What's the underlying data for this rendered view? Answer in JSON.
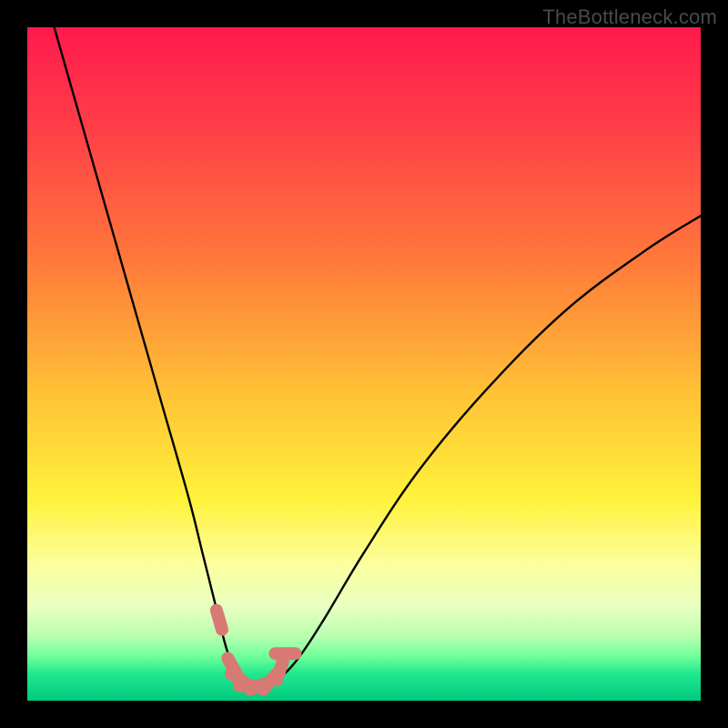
{
  "watermark": "TheBottleneck.com",
  "colors": {
    "frame": "#000000",
    "curve_stroke": "#000000",
    "marker_fill": "#d77a74",
    "marker_stroke": "#c56a64",
    "gradient_stops": [
      {
        "offset": 0.0,
        "color": "#ff1a4d"
      },
      {
        "offset": 0.15,
        "color": "#ff3e48"
      },
      {
        "offset": 0.35,
        "color": "#ff7a3a"
      },
      {
        "offset": 0.55,
        "color": "#ffc436"
      },
      {
        "offset": 0.7,
        "color": "#fff23a"
      },
      {
        "offset": 0.8,
        "color": "#fbffa0"
      },
      {
        "offset": 0.86,
        "color": "#e9ffc0"
      },
      {
        "offset": 0.905,
        "color": "#b8ffb0"
      },
      {
        "offset": 0.935,
        "color": "#6dff9a"
      },
      {
        "offset": 0.96,
        "color": "#20e88f"
      },
      {
        "offset": 1.0,
        "color": "#00c97e"
      }
    ]
  },
  "chart_data": {
    "type": "line",
    "title": "",
    "xlabel": "",
    "ylabel": "",
    "xlim": [
      0,
      100
    ],
    "ylim": [
      0,
      100
    ],
    "series": [
      {
        "name": "bottleneck-curve",
        "x": [
          4,
          8,
          12,
          16,
          20,
          24,
          26,
          28,
          29.5,
          31,
          33,
          35,
          37,
          40,
          44,
          50,
          58,
          68,
          80,
          92,
          100
        ],
        "values": [
          100,
          86,
          72,
          58,
          44,
          30,
          22,
          14,
          8,
          4,
          2,
          2,
          3,
          6,
          12,
          22,
          34,
          46,
          58,
          67,
          72
        ]
      }
    ],
    "markers": {
      "name": "highlight-points",
      "x": [
        28.5,
        30.5,
        31.5,
        33.0,
        34.5,
        36.0,
        37.5,
        38.3
      ],
      "values": [
        12.0,
        5.0,
        3.2,
        2.2,
        2.2,
        2.8,
        4.5,
        7.0
      ]
    }
  }
}
